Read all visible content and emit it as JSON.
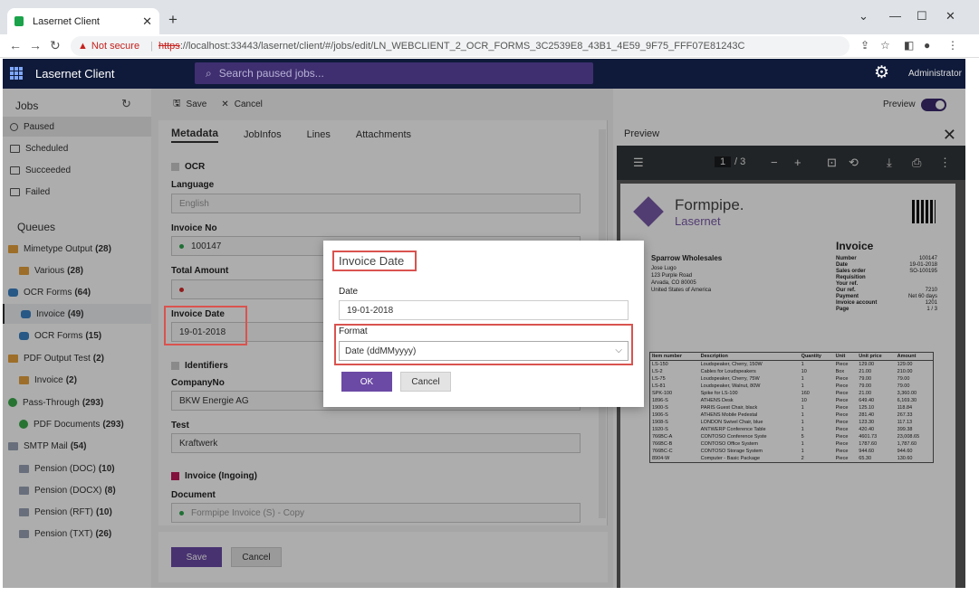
{
  "browser": {
    "tab_title": "Lasernet Client",
    "not_secure": "Not secure",
    "url_scheme": "https",
    "url_rest": "://localhost:33443/lasernet/client/#/jobs/edit/LN_WEBCLIENT_2_OCR_FORMS_3C2539E8_43B1_4E59_9F75_FFF07E81243C"
  },
  "app": {
    "brand": "Lasernet Client",
    "search_placeholder": "Search paused jobs...",
    "user": "Administrator"
  },
  "sidebar": {
    "jobs_heading": "Jobs",
    "jobs": [
      {
        "label": "Paused"
      },
      {
        "label": "Scheduled"
      },
      {
        "label": "Succeeded"
      },
      {
        "label": "Failed"
      }
    ],
    "queues_heading": "Queues",
    "queues": [
      {
        "label": "Mimetype Output",
        "count": "(28)"
      },
      {
        "label": "Various",
        "count": "(28)"
      },
      {
        "label": "OCR Forms",
        "count": "(64)"
      },
      {
        "label": "Invoice",
        "count": "(49)"
      },
      {
        "label": "OCR Forms",
        "count": "(15)"
      },
      {
        "label": "PDF Output Test",
        "count": "(2)"
      },
      {
        "label": "Invoice",
        "count": "(2)"
      },
      {
        "label": "Pass-Through",
        "count": "(293)"
      },
      {
        "label": "PDF Documents",
        "count": "(293)"
      },
      {
        "label": "SMTP Mail",
        "count": "(54)"
      },
      {
        "label": "Pension (DOC)",
        "count": "(10)"
      },
      {
        "label": "Pension (DOCX)",
        "count": "(8)"
      },
      {
        "label": "Pension (RFT)",
        "count": "(10)"
      },
      {
        "label": "Pension (TXT)",
        "count": "(26)"
      }
    ]
  },
  "toolbar": {
    "save": "Save",
    "cancel": "Cancel"
  },
  "tabs": [
    "Metadata",
    "JobInfos",
    "Lines",
    "Attachments"
  ],
  "form": {
    "ocr_section": "OCR",
    "language_label": "Language",
    "language_value": "English",
    "invoice_no_label": "Invoice No",
    "invoice_no_value": "100147",
    "total_amount_label": "Total Amount",
    "invoice_date_label": "Invoice Date",
    "invoice_date_value": "19-01-2018",
    "identifiers_section": "Identifiers",
    "company_label": "CompanyNo",
    "company_value": "BKW Energie AG",
    "test_label": "Test",
    "test_value": "Kraftwerk",
    "invoice_section": "Invoice (Ingoing)",
    "document_label": "Document",
    "document_value": "Formpipe Invoice (S) - Copy"
  },
  "footer": {
    "save": "Save",
    "cancel": "Cancel"
  },
  "preview": {
    "title": "Preview",
    "toggle_label": "Preview",
    "page_current": "1",
    "page_total": "/ 3",
    "logo_top": "Formpipe.",
    "logo_bottom": "Lasernet",
    "doc_title": "Invoice",
    "customer": "Sparrow Wholesales",
    "addr1": "Jose Lugo",
    "addr2": "123 Purple Road",
    "addr3": "Arvada, CO 80005",
    "addr4": "United States of America",
    "meta": [
      {
        "k": "Number",
        "v": "100147"
      },
      {
        "k": "Date",
        "v": "19-01-2018"
      },
      {
        "k": "Sales order",
        "v": "SO-100195"
      },
      {
        "k": "Requisition",
        "v": ""
      },
      {
        "k": "Your ref.",
        "v": ""
      },
      {
        "k": "Our ref.",
        "v": "7210"
      },
      {
        "k": "Payment",
        "v": "Net 60 days"
      },
      {
        "k": "Invoice account",
        "v": "1201"
      },
      {
        "k": "Page",
        "v": "1 / 3"
      }
    ],
    "cols": [
      "Item number",
      "Description",
      "Quantity",
      "Unit",
      "Unit price",
      "Amount"
    ],
    "rows": [
      [
        "LS-150",
        "Loudspeaker, Cherry, 150W",
        "1",
        "Piece",
        "129.00",
        "129.00"
      ],
      [
        "LS-2",
        "Cables for Loudspeakers",
        "10",
        "Box",
        "21.00",
        "210.00"
      ],
      [
        "LS-75",
        "Loudspeaker, Cherry, 75W",
        "1",
        "Piece",
        "79.00",
        "79.00"
      ],
      [
        "LS-81",
        "Loudspeaker, Walnut, 80W",
        "1",
        "Piece",
        "79.00",
        "79.00"
      ],
      [
        "SPK-100",
        "Spike for LS-100",
        "160",
        "Piece",
        "21.00",
        "3,360.00"
      ],
      [
        "1896-S",
        "ATHENS Desk",
        "10",
        "Piece",
        "649.40",
        "6,169.30"
      ],
      [
        "1900-S",
        "PARIS Guest Chair, black",
        "1",
        "Piece",
        "125.10",
        "118.84"
      ],
      [
        "1906-S",
        "ATHENS Mobile Pedestal",
        "1",
        "Piece",
        "281.40",
        "267.33"
      ],
      [
        "1908-S",
        "LONDON Swivel Chair, blue",
        "1",
        "Piece",
        "123.30",
        "117.13"
      ],
      [
        "1920-S",
        "ANTWERP Conference Table",
        "1",
        "Piece",
        "420.40",
        "399.38"
      ],
      [
        "766BC-A",
        "CONTOSO Conference Syste",
        "5",
        "Piece",
        "4601.73",
        "23,008.65"
      ],
      [
        "766BC-B",
        "CONTOSO Office System",
        "1",
        "Piece",
        "1787.60",
        "1,787.60"
      ],
      [
        "766BC-C",
        "CONTOSO Storage System",
        "1",
        "Piece",
        "944.60",
        "944.60"
      ],
      [
        "8904-W",
        "Computer - Basic Package",
        "2",
        "Piece",
        "65.30",
        "130.60"
      ]
    ]
  },
  "dialog": {
    "title": "Invoice Date",
    "date_label": "Date",
    "date_value": "19-01-2018",
    "format_label": "Format",
    "format_value": "Date (ddMMyyyy)",
    "ok": "OK",
    "cancel": "Cancel"
  },
  "colors": {
    "accent": "#6b4aa5",
    "header": "#0f1a3a",
    "highlight": "#d9534f"
  }
}
